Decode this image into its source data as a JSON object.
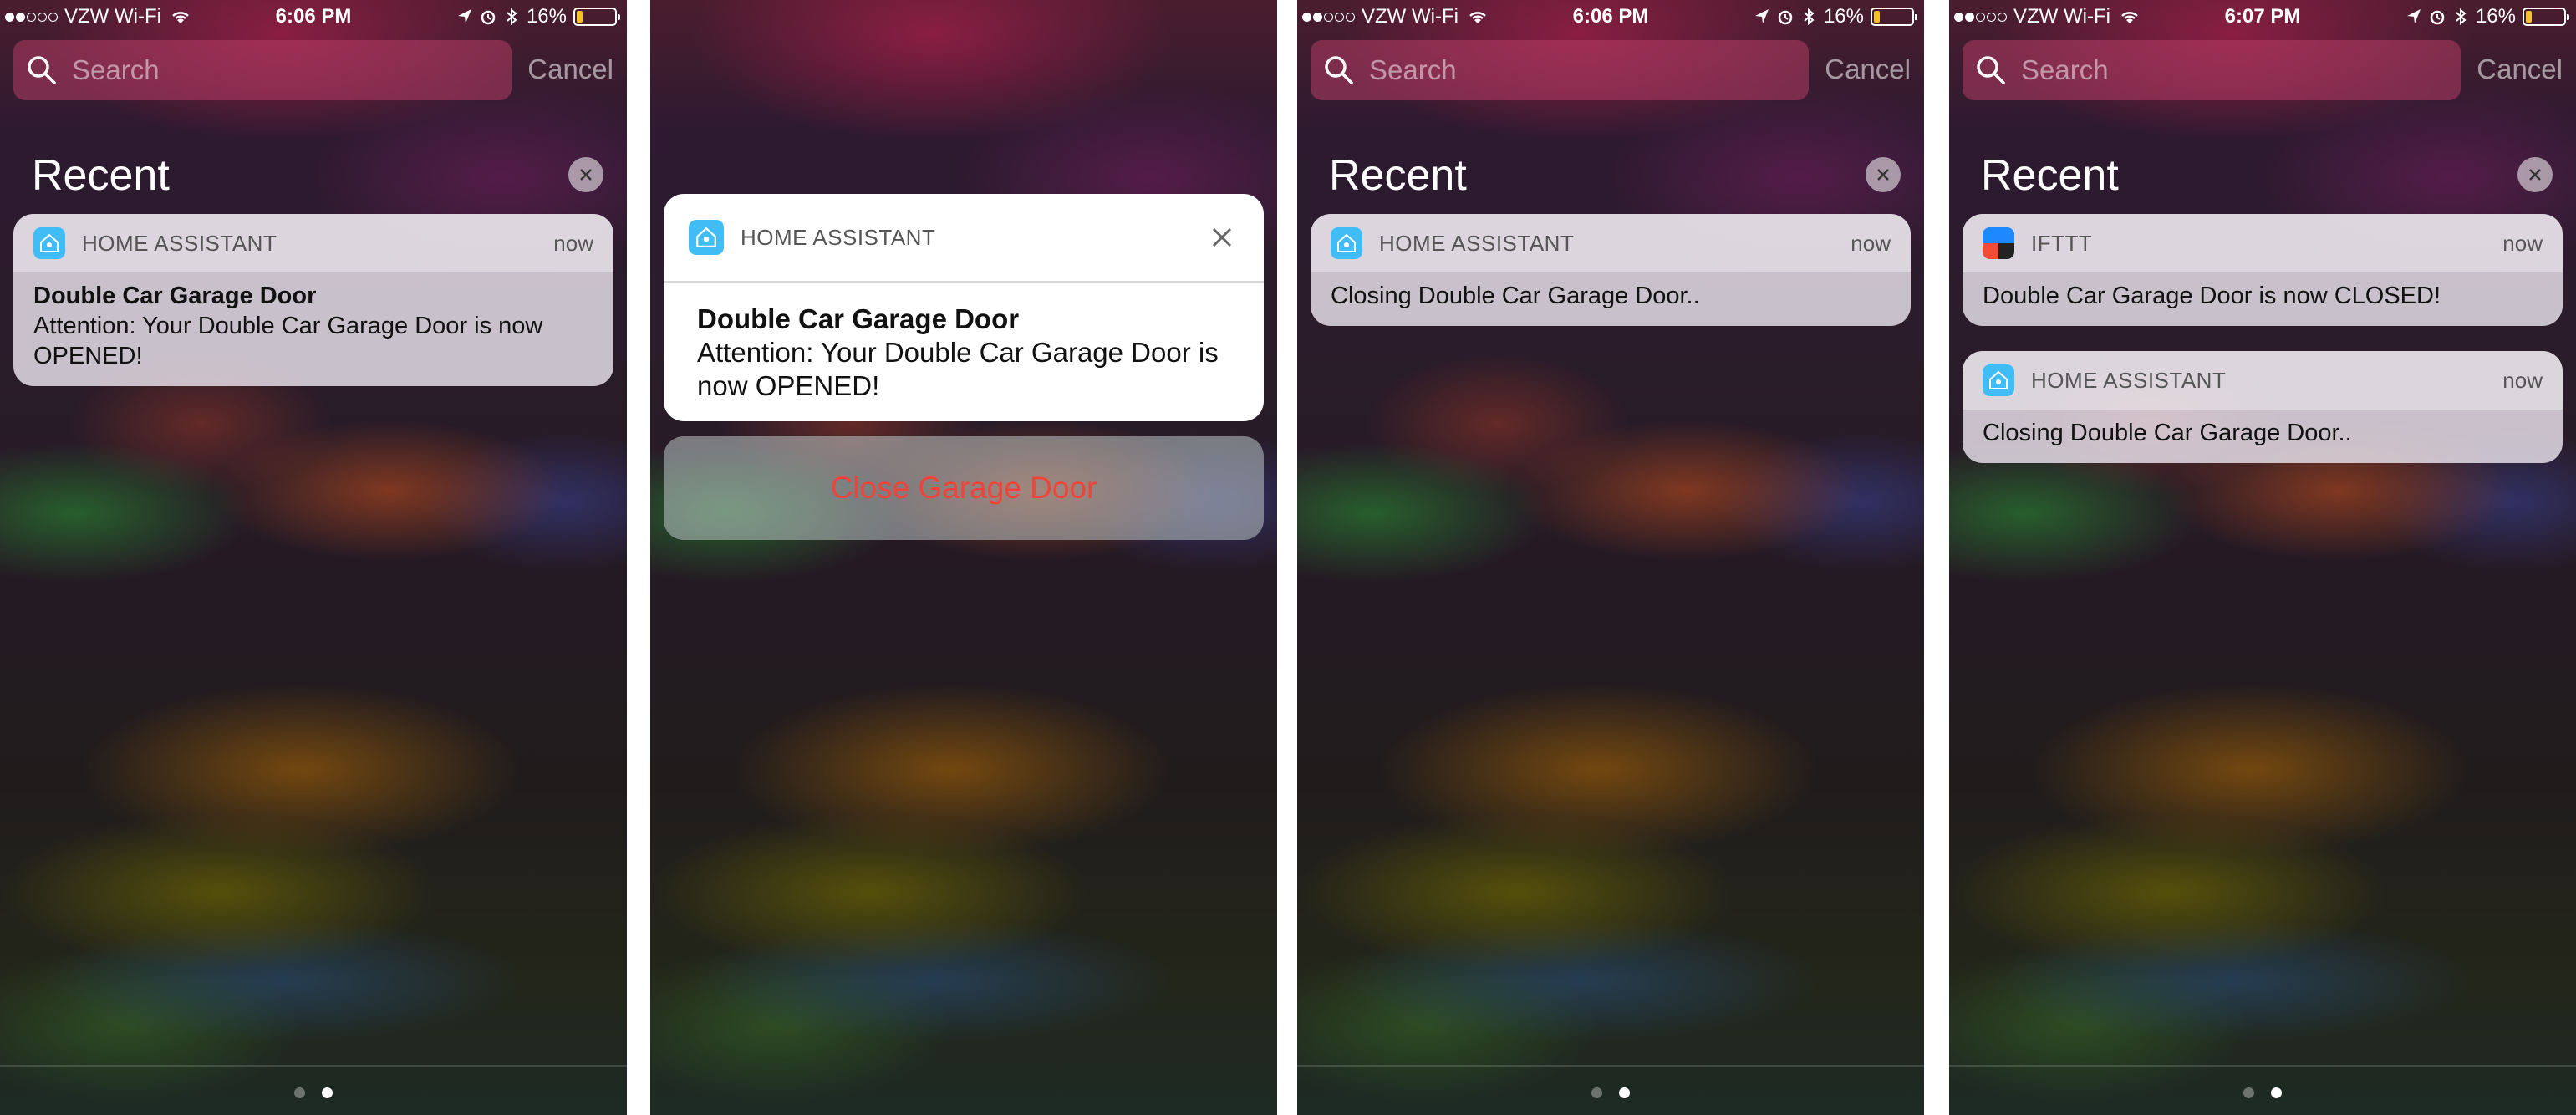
{
  "screens": [
    {
      "status": {
        "carrier": "VZW Wi-Fi",
        "time": "6:06 PM",
        "battery": "16%",
        "battery_level": 0.16
      },
      "search": {
        "placeholder": "Search",
        "cancel": "Cancel"
      },
      "section": {
        "title": "Recent"
      },
      "notifications": [
        {
          "app": "HOME ASSISTANT",
          "time": "now",
          "title": "Double Car Garage Door",
          "body": "Attention: Your Double Car Garage Door is now OPENED!"
        }
      ]
    },
    {
      "expanded": {
        "app": "HOME ASSISTANT",
        "title": "Double Car Garage Door",
        "body": "Attention: Your Double Car Garage Door is now OPENED!",
        "action": "Close Garage Door"
      }
    },
    {
      "status": {
        "carrier": "VZW Wi-Fi",
        "time": "6:06 PM",
        "battery": "16%",
        "battery_level": 0.16
      },
      "search": {
        "placeholder": "Search",
        "cancel": "Cancel"
      },
      "section": {
        "title": "Recent"
      },
      "notifications": [
        {
          "app": "HOME ASSISTANT",
          "time": "now",
          "body": "Closing Double Car Garage Door.."
        }
      ]
    },
    {
      "status": {
        "carrier": "VZW Wi-Fi",
        "time": "6:07 PM",
        "battery": "16%",
        "battery_level": 0.16
      },
      "search": {
        "placeholder": "Search",
        "cancel": "Cancel"
      },
      "section": {
        "title": "Recent"
      },
      "notifications": [
        {
          "app": "IFTTT",
          "time": "now",
          "body": "Double Car Garage Door is now CLOSED!"
        },
        {
          "app": "HOME ASSISTANT",
          "time": "now",
          "body": "Closing Double Car Garage Door.."
        }
      ]
    }
  ],
  "colors": {
    "action_red": "#f0433a",
    "home_assistant_blue": "#41bdf5",
    "battery_yellow": "#f4c22b"
  },
  "icons": [
    "search-icon",
    "wifi-icon",
    "location-icon",
    "alarm-icon",
    "bluetooth-icon",
    "battery-icon",
    "clear-icon",
    "close-icon",
    "home-assistant-icon",
    "ifttt-icon"
  ]
}
